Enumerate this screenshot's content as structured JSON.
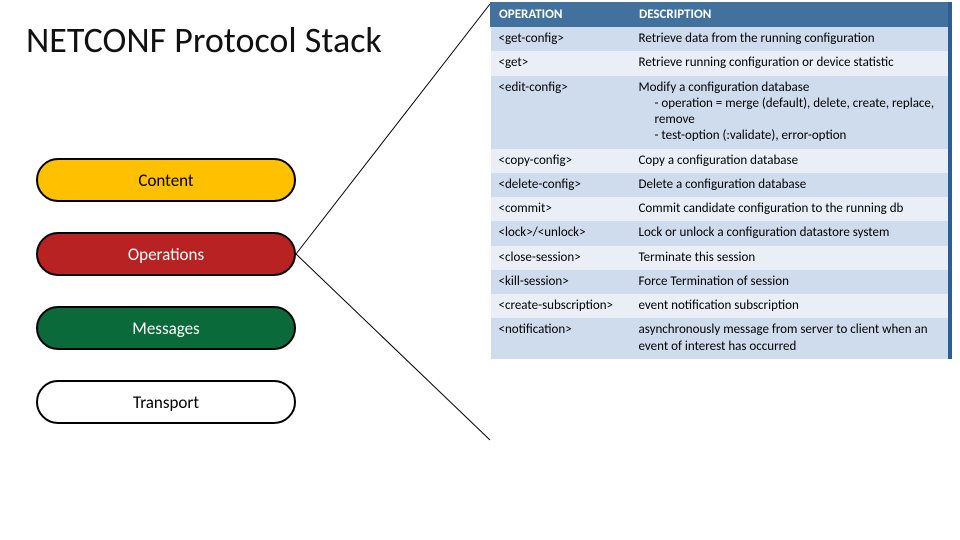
{
  "title": "NETCONF Protocol Stack",
  "layers": {
    "content": "Content",
    "operations": "Operations",
    "messages": "Messages",
    "transport": "Transport"
  },
  "table": {
    "headers": {
      "op": "OPERATION",
      "desc": "DESCRIPTION"
    },
    "rows": [
      {
        "op": "<get-config>",
        "desc": "Retrieve data from the running configuration"
      },
      {
        "op": "<get>",
        "desc": "Retrieve running configuration or device statistic"
      },
      {
        "op": "<edit-config>",
        "desc": "Modify a configuration database",
        "sub": [
          "operation = merge (default), delete, create, replace, remove",
          "test-option (:validate), error-option"
        ]
      },
      {
        "op": "<copy-config>",
        "desc": "Copy a configuration database"
      },
      {
        "op": "<delete-config>",
        "desc": "Delete a configuration database"
      },
      {
        "op": "<commit>",
        "desc": "Commit candidate configuration to the running db"
      },
      {
        "op": "<lock>/<unlock>",
        "desc": "Lock or unlock a configuration datastore system"
      },
      {
        "op": "<close-session>",
        "desc": "Terminate this session"
      },
      {
        "op": "<kill-session>",
        "desc": "Force Termination of session"
      },
      {
        "op": "<create-subscription>",
        "desc": "event notification subscription"
      },
      {
        "op": "<notification>",
        "desc": "asynchronously message from server to client when an event of interest has occurred"
      }
    ]
  }
}
